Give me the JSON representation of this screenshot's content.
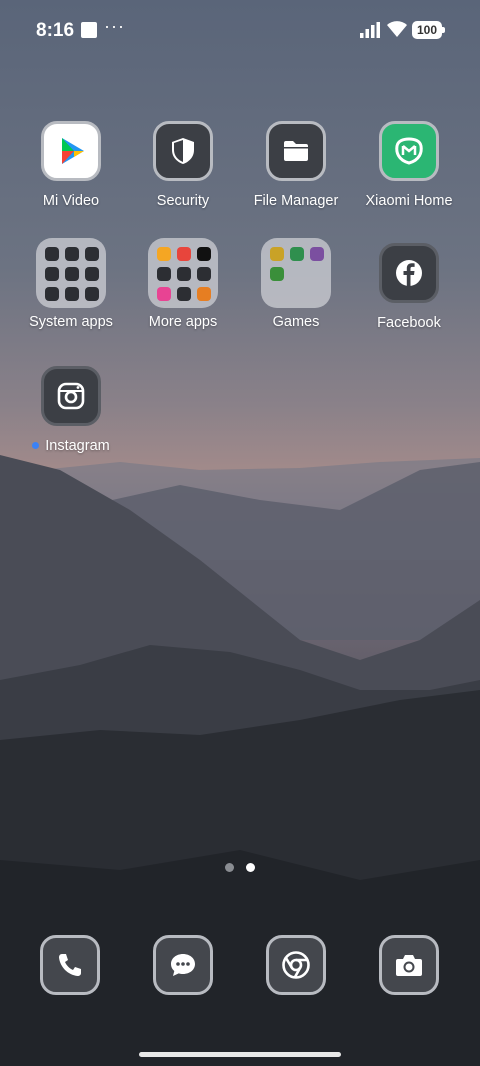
{
  "status_bar": {
    "time": "8:16",
    "more_indicator": "···",
    "battery_level": "100",
    "icons": [
      "notification-square-icon",
      "signal-icon",
      "wifi-icon",
      "battery-icon"
    ]
  },
  "apps": [
    {
      "label": "Mi Video",
      "icon": "play-icon"
    },
    {
      "label": "Security",
      "icon": "shield-icon"
    },
    {
      "label": "File Manager",
      "icon": "folder-icon"
    },
    {
      "label": "Xiaomi Home",
      "icon": "mi-home-icon"
    },
    {
      "label": "Facebook",
      "icon": "facebook-icon"
    },
    {
      "label": "Instagram",
      "icon": "camera-icon",
      "new_indicator": true
    }
  ],
  "folders": [
    {
      "label": "System apps"
    },
    {
      "label": "More apps"
    },
    {
      "label": "Games"
    }
  ],
  "pager": {
    "total_pages": 2,
    "current_page": 2
  },
  "dock": [
    {
      "name": "phone",
      "icon": "phone-icon"
    },
    {
      "name": "messages",
      "icon": "message-icon"
    },
    {
      "name": "chrome",
      "icon": "chrome-icon"
    },
    {
      "name": "camera",
      "icon": "camera-icon"
    }
  ],
  "colors": {
    "accent_new_dot": "#3b82f6",
    "xiaomi_home_green": "#2bb673",
    "icon_background": "#3c3f45"
  }
}
